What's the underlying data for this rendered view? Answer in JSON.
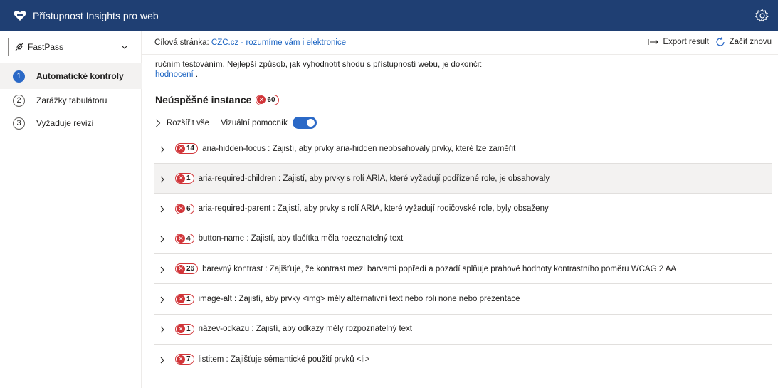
{
  "app": {
    "title": "Přístupnost Insights pro web"
  },
  "leftnav": {
    "dropdown_value": "FastPass",
    "items": [
      {
        "number": "1",
        "label": "Automatické kontroly"
      },
      {
        "number": "2",
        "label": "Zarážky tabulátoru"
      },
      {
        "number": "3",
        "label": "Vyžaduje revizi"
      }
    ]
  },
  "cmdbar": {
    "target_label": "Cílová stránka:",
    "target_link": "CZC.cz - rozumíme vám i elektronice",
    "export_label": "Export result",
    "restart_label": "Začít znovu"
  },
  "main": {
    "intro_text": "ručním testováním. Nejlepší způsob, jak vyhodnotit shodu s přístupností webu, je dokončit",
    "intro_link": "hodnocení",
    "intro_end": ".",
    "failed_title": "Neúspěšné instance",
    "failed_count": "60",
    "expand_all": "Rozšířit vše",
    "visual_helper": "Vizuální pomocník",
    "visual_helper_on": true,
    "rules": [
      {
        "count": "14",
        "text": "aria-hidden-focus : Zajistí, aby prvky aria-hidden neobsahovaly prvky, které lze zaměřit"
      },
      {
        "count": "1",
        "text": "aria-required-children : Zajistí, aby prvky s rolí ARIA, které vyžadují podřízené role, je obsahovaly"
      },
      {
        "count": "6",
        "text": "aria-required-parent : Zajistí, aby prvky s rolí ARIA, které vyžadují rodičovské role, byly obsaženy"
      },
      {
        "count": "4",
        "text": "button-name : Zajistí, aby tlačítka měla rozeznatelný text"
      },
      {
        "count": "26",
        "text": "barevný kontrast : Zajišťuje, že kontrast mezi barvami popředí a pozadí splňuje prahové hodnoty kontrastního poměru WCAG 2 AA"
      },
      {
        "count": "1",
        "text": "image-alt : Zajistí, aby prvky <img> měly alternativní text nebo roli none nebo prezentace"
      },
      {
        "count": "1",
        "text": "název-odkazu : Zajistí, aby odkazy měly rozpoznatelný text"
      },
      {
        "count": "7",
        "text": "listitem : Zajišťuje sémantické použití prvků <li>"
      }
    ]
  },
  "colors": {
    "titlebar": "#1f3f73",
    "accent": "#2b69c7",
    "error": "#d13438",
    "link": "#1a63c2"
  }
}
